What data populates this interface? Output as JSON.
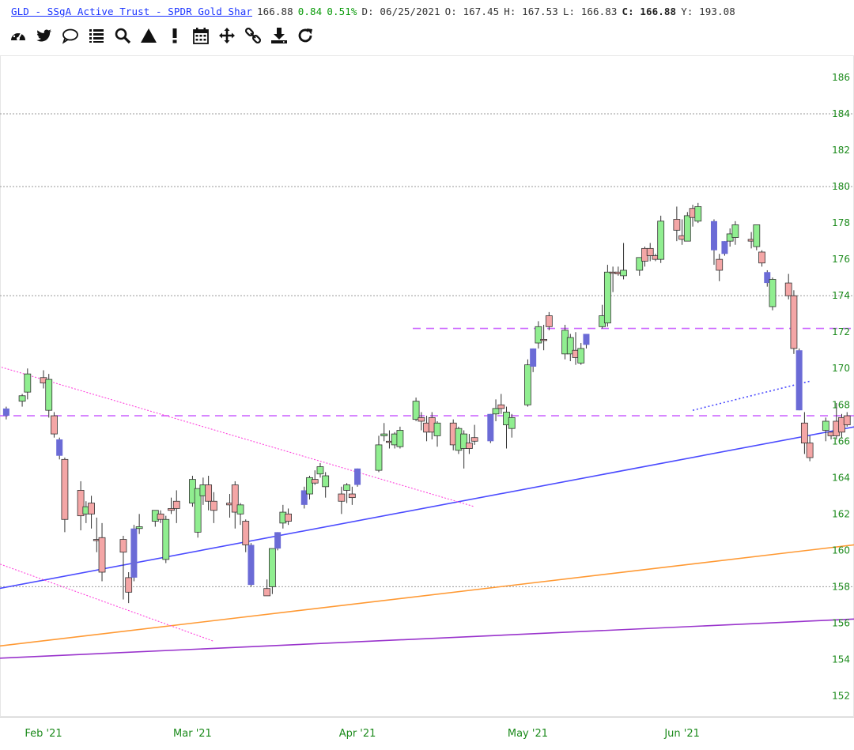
{
  "header": {
    "name": "GLD - SSgA Active Trust - SPDR Gold Shar",
    "last": "166.88",
    "change": "0.84",
    "change_pct": "0.51%",
    "date": "D: 06/25/2021",
    "open": "O: 167.45",
    "high": "H: 167.53",
    "low": "L: 166.83",
    "close_label": "C:",
    "close": "166.88",
    "yearly": "Y: 193.08"
  },
  "toolbar": [
    {
      "name": "dashboard-icon"
    },
    {
      "name": "twitter-icon"
    },
    {
      "name": "comment-icon"
    },
    {
      "name": "list-icon"
    },
    {
      "name": "search-icon"
    },
    {
      "name": "triangle-icon"
    },
    {
      "name": "alert-icon"
    },
    {
      "name": "calendar-icon"
    },
    {
      "name": "move-icon"
    },
    {
      "name": "link-icon"
    },
    {
      "name": "download-icon"
    },
    {
      "name": "refresh-icon"
    }
  ],
  "colors": {
    "up": "#90ee90",
    "down": "#f4a6a6",
    "gap_up": "#6b6bd6",
    "gap_down": "#6b6bd6",
    "tick": "#1b8a1b",
    "support": "#4b4bff",
    "orange_line": "#ff9933",
    "purple_line": "#9933cc",
    "pink_line": "#ff44dd",
    "hline": "#cc66ff"
  },
  "chart_data": {
    "type": "candlestick",
    "y_ticks": [
      "152",
      "154",
      "156",
      "158",
      "160",
      "162",
      "164",
      "166",
      "168",
      "170",
      "172",
      "174",
      "176",
      "178",
      "180",
      "182",
      "184",
      "186"
    ],
    "x_ticks": [
      {
        "label": "Feb '21",
        "date": "2021-02-01"
      },
      {
        "label": "Mar '21",
        "date": "2021-03-01"
      },
      {
        "label": "Apr '21",
        "date": "2021-04-01"
      },
      {
        "label": "May '21",
        "date": "2021-05-03"
      },
      {
        "label": "Jun '21",
        "date": "2021-06-01"
      }
    ],
    "ylim": [
      151.5,
      187
    ],
    "grid_levels": [
      158,
      174,
      180,
      184
    ],
    "horizontal_levels": [
      167.4,
      172.2
    ],
    "trendlines": [
      {
        "kind": "support",
        "from": [
          "2021-01-11",
          157.2
        ],
        "to": [
          "2021-07-09",
          167.1
        ]
      },
      {
        "kind": "support-extension",
        "from": [
          "2021-06-03",
          167.7
        ],
        "to": [
          "2021-06-25",
          169.3
        ]
      },
      {
        "kind": "orange",
        "from": [
          "2021-01-11",
          154.3
        ],
        "to": [
          "2021-07-09",
          160.5
        ]
      },
      {
        "kind": "purple",
        "from": [
          "2021-01-11",
          153.9
        ],
        "to": [
          "2021-07-09",
          156.3
        ]
      },
      {
        "kind": "pink-upper",
        "from": [
          "2021-01-11",
          171.2
        ],
        "to": [
          "2021-04-23",
          162.4
        ]
      },
      {
        "kind": "pink-lower",
        "from": [
          "2021-01-11",
          160.6
        ],
        "to": [
          "2021-03-05",
          155.0
        ]
      }
    ],
    "candles": [
      {
        "d": "2021-01-25",
        "o": 167.4,
        "h": 167.9,
        "l": 167.2,
        "c": 167.8,
        "s": "gap"
      },
      {
        "d": "2021-01-28",
        "o": 168.2,
        "h": 168.6,
        "l": 167.9,
        "c": 168.5,
        "s": "up"
      },
      {
        "d": "2021-01-29",
        "o": 168.7,
        "h": 170.0,
        "l": 168.3,
        "c": 169.7,
        "s": "up"
      },
      {
        "d": "2021-02-01",
        "o": 169.5,
        "h": 169.9,
        "l": 168.9,
        "c": 169.2,
        "s": "down"
      },
      {
        "d": "2021-02-02",
        "o": 169.4,
        "h": 169.7,
        "l": 167.3,
        "c": 167.7,
        "s": "up"
      },
      {
        "d": "2021-02-03",
        "o": 167.4,
        "h": 167.6,
        "l": 166.2,
        "c": 166.4,
        "s": "down"
      },
      {
        "d": "2021-02-04",
        "o": 166.1,
        "h": 166.2,
        "l": 165.0,
        "c": 165.2,
        "s": "gap"
      },
      {
        "d": "2021-02-05",
        "o": 165.0,
        "h": 165.1,
        "l": 161.0,
        "c": 161.7,
        "s": "down"
      },
      {
        "d": "2021-02-08",
        "o": 163.3,
        "h": 163.8,
        "l": 161.1,
        "c": 161.9,
        "s": "down"
      },
      {
        "d": "2021-02-09",
        "o": 162.0,
        "h": 162.7,
        "l": 161.5,
        "c": 162.4,
        "s": "up"
      },
      {
        "d": "2021-02-10",
        "o": 162.6,
        "h": 163.0,
        "l": 161.2,
        "c": 162.0,
        "s": "down"
      },
      {
        "d": "2021-02-11",
        "o": 160.6,
        "h": 161.8,
        "l": 159.9,
        "c": 160.6,
        "s": "down"
      },
      {
        "d": "2021-02-12",
        "o": 160.7,
        "h": 161.5,
        "l": 158.3,
        "c": 158.8,
        "s": "down"
      },
      {
        "d": "2021-02-16",
        "o": 160.6,
        "h": 160.8,
        "l": 157.3,
        "c": 159.9,
        "s": "down"
      },
      {
        "d": "2021-02-17",
        "o": 158.5,
        "h": 158.8,
        "l": 157.1,
        "c": 157.7,
        "s": "down"
      },
      {
        "d": "2021-02-18",
        "o": 158.5,
        "h": 161.4,
        "l": 158.3,
        "c": 161.2,
        "s": "gap"
      },
      {
        "d": "2021-02-19",
        "o": 161.2,
        "h": 162.0,
        "l": 160.9,
        "c": 161.3,
        "s": "up"
      },
      {
        "d": "2021-02-22",
        "o": 161.6,
        "h": 162.2,
        "l": 161.3,
        "c": 162.2,
        "s": "up"
      },
      {
        "d": "2021-02-23",
        "o": 162.0,
        "h": 162.2,
        "l": 161.5,
        "c": 161.7,
        "s": "down"
      },
      {
        "d": "2021-02-24",
        "o": 159.5,
        "h": 161.9,
        "l": 159.3,
        "c": 161.7,
        "s": "up"
      },
      {
        "d": "2021-02-25",
        "o": 162.2,
        "h": 162.9,
        "l": 162.0,
        "c": 162.3,
        "s": "down"
      },
      {
        "d": "2021-02-26",
        "o": 162.3,
        "h": 163.3,
        "l": 161.5,
        "c": 162.7,
        "s": "down"
      },
      {
        "d": "2021-03-01",
        "o": 162.6,
        "h": 164.1,
        "l": 162.4,
        "c": 163.9,
        "s": "up"
      },
      {
        "d": "2021-03-02",
        "o": 161.0,
        "h": 163.4,
        "l": 160.7,
        "c": 163.4,
        "s": "up"
      },
      {
        "d": "2021-03-03",
        "o": 163.0,
        "h": 164.0,
        "l": 162.5,
        "c": 163.6,
        "s": "up"
      },
      {
        "d": "2021-03-04",
        "o": 163.6,
        "h": 164.1,
        "l": 162.2,
        "c": 162.7,
        "s": "down"
      },
      {
        "d": "2021-03-05",
        "o": 162.7,
        "h": 163.2,
        "l": 161.5,
        "c": 162.2,
        "s": "down"
      },
      {
        "d": "2021-03-08",
        "o": 162.5,
        "h": 163.1,
        "l": 161.8,
        "c": 162.6,
        "s": "down"
      },
      {
        "d": "2021-03-09",
        "o": 163.6,
        "h": 163.8,
        "l": 161.2,
        "c": 162.1,
        "s": "down"
      },
      {
        "d": "2021-03-10",
        "o": 162.0,
        "h": 162.6,
        "l": 161.4,
        "c": 162.5,
        "s": "up"
      },
      {
        "d": "2021-03-11",
        "o": 161.6,
        "h": 161.7,
        "l": 159.9,
        "c": 160.3,
        "s": "down"
      },
      {
        "d": "2021-03-12",
        "o": 160.3,
        "h": 160.4,
        "l": 158.0,
        "c": 158.1,
        "s": "gap"
      },
      {
        "d": "2021-03-15",
        "o": 157.9,
        "h": 158.4,
        "l": 157.6,
        "c": 157.5,
        "s": "down"
      },
      {
        "d": "2021-03-16",
        "o": 158.0,
        "h": 160.1,
        "l": 157.6,
        "c": 160.1,
        "s": "up"
      },
      {
        "d": "2021-03-17",
        "o": 160.1,
        "h": 161.0,
        "l": 160.0,
        "c": 161.0,
        "s": "gap"
      },
      {
        "d": "2021-03-18",
        "o": 161.5,
        "h": 162.5,
        "l": 161.2,
        "c": 162.1,
        "s": "up"
      },
      {
        "d": "2021-03-19",
        "o": 162.0,
        "h": 162.3,
        "l": 161.4,
        "c": 161.6,
        "s": "down"
      },
      {
        "d": "2021-03-22",
        "o": 162.5,
        "h": 163.5,
        "l": 162.3,
        "c": 163.3,
        "s": "gap"
      },
      {
        "d": "2021-03-23",
        "o": 163.1,
        "h": 164.1,
        "l": 162.8,
        "c": 164.0,
        "s": "up"
      },
      {
        "d": "2021-03-24",
        "o": 163.9,
        "h": 164.4,
        "l": 163.6,
        "c": 163.7,
        "s": "down"
      },
      {
        "d": "2021-03-25",
        "o": 164.2,
        "h": 164.8,
        "l": 164.0,
        "c": 164.6,
        "s": "up"
      },
      {
        "d": "2021-03-26",
        "o": 163.5,
        "h": 164.3,
        "l": 162.9,
        "c": 164.1,
        "s": "up"
      },
      {
        "d": "2021-03-29",
        "o": 163.1,
        "h": 163.5,
        "l": 162.0,
        "c": 162.7,
        "s": "down"
      },
      {
        "d": "2021-03-30",
        "o": 163.3,
        "h": 163.7,
        "l": 162.6,
        "c": 163.6,
        "s": "up"
      },
      {
        "d": "2021-03-31",
        "o": 163.1,
        "h": 163.5,
        "l": 162.5,
        "c": 162.9,
        "s": "down"
      },
      {
        "d": "2021-04-01",
        "o": 163.6,
        "h": 164.5,
        "l": 163.5,
        "c": 164.5,
        "s": "gap"
      },
      {
        "d": "2021-04-05",
        "o": 164.4,
        "h": 166.3,
        "l": 164.3,
        "c": 165.8,
        "s": "up"
      },
      {
        "d": "2021-04-06",
        "o": 166.3,
        "h": 167.0,
        "l": 166.0,
        "c": 166.4,
        "s": "up"
      },
      {
        "d": "2021-04-07",
        "o": 166.0,
        "h": 166.6,
        "l": 165.6,
        "c": 166.0,
        "s": "down"
      },
      {
        "d": "2021-04-08",
        "o": 165.8,
        "h": 166.5,
        "l": 165.6,
        "c": 166.4,
        "s": "up"
      },
      {
        "d": "2021-04-09",
        "o": 165.7,
        "h": 166.8,
        "l": 165.6,
        "c": 166.6,
        "s": "up"
      },
      {
        "d": "2021-04-12",
        "o": 167.2,
        "h": 168.4,
        "l": 167.1,
        "c": 168.2,
        "s": "up"
      },
      {
        "d": "2021-04-13",
        "o": 167.3,
        "h": 167.6,
        "l": 166.6,
        "c": 167.1,
        "s": "down"
      },
      {
        "d": "2021-04-14",
        "o": 167.0,
        "h": 167.4,
        "l": 166.0,
        "c": 166.5,
        "s": "down"
      },
      {
        "d": "2021-04-15",
        "o": 167.3,
        "h": 167.6,
        "l": 166.1,
        "c": 166.5,
        "s": "down"
      },
      {
        "d": "2021-04-16",
        "o": 166.3,
        "h": 167.1,
        "l": 165.7,
        "c": 167.0,
        "s": "up"
      },
      {
        "d": "2021-04-19",
        "o": 167.0,
        "h": 167.2,
        "l": 165.5,
        "c": 165.8,
        "s": "down"
      },
      {
        "d": "2021-04-20",
        "o": 165.5,
        "h": 166.8,
        "l": 165.3,
        "c": 166.7,
        "s": "up"
      },
      {
        "d": "2021-04-21",
        "o": 166.4,
        "h": 166.6,
        "l": 164.5,
        "c": 165.6,
        "s": "up"
      },
      {
        "d": "2021-04-22",
        "o": 165.9,
        "h": 166.4,
        "l": 165.3,
        "c": 165.6,
        "s": "down"
      },
      {
        "d": "2021-04-23",
        "o": 166.0,
        "h": 166.9,
        "l": 165.8,
        "c": 166.2,
        "s": "down"
      },
      {
        "d": "2021-04-26",
        "o": 166.0,
        "h": 167.5,
        "l": 165.9,
        "c": 167.5,
        "s": "gap"
      },
      {
        "d": "2021-04-27",
        "o": 167.5,
        "h": 168.3,
        "l": 167.1,
        "c": 167.8,
        "s": "up"
      },
      {
        "d": "2021-04-28",
        "o": 168.0,
        "h": 168.6,
        "l": 167.5,
        "c": 167.8,
        "s": "down"
      },
      {
        "d": "2021-04-29",
        "o": 166.9,
        "h": 167.9,
        "l": 165.6,
        "c": 167.6,
        "s": "up"
      },
      {
        "d": "2021-04-30",
        "o": 166.7,
        "h": 167.5,
        "l": 166.2,
        "c": 167.3,
        "s": "up"
      },
      {
        "d": "2021-05-03",
        "o": 168.0,
        "h": 170.5,
        "l": 167.9,
        "c": 170.2,
        "s": "up"
      },
      {
        "d": "2021-05-04",
        "o": 170.1,
        "h": 171.1,
        "l": 169.8,
        "c": 171.1,
        "s": "gap"
      },
      {
        "d": "2021-05-05",
        "o": 171.4,
        "h": 172.6,
        "l": 171.1,
        "c": 172.3,
        "s": "up"
      },
      {
        "d": "2021-05-06",
        "o": 171.6,
        "h": 172.4,
        "l": 171.0,
        "c": 171.6,
        "s": "down"
      },
      {
        "d": "2021-05-07",
        "o": 172.9,
        "h": 173.1,
        "l": 172.1,
        "c": 172.3,
        "s": "down"
      },
      {
        "d": "2021-05-10",
        "o": 172.1,
        "h": 172.4,
        "l": 170.5,
        "c": 170.8,
        "s": "up"
      },
      {
        "d": "2021-05-11",
        "o": 170.8,
        "h": 171.9,
        "l": 170.4,
        "c": 171.7,
        "s": "up"
      },
      {
        "d": "2021-05-12",
        "o": 171.0,
        "h": 172.0,
        "l": 170.2,
        "c": 170.6,
        "s": "down"
      },
      {
        "d": "2021-05-13",
        "o": 170.3,
        "h": 171.4,
        "l": 170.2,
        "c": 171.1,
        "s": "up"
      },
      {
        "d": "2021-05-14",
        "o": 171.3,
        "h": 171.9,
        "l": 171.1,
        "c": 171.9,
        "s": "gap"
      },
      {
        "d": "2021-05-17",
        "o": 172.3,
        "h": 173.5,
        "l": 172.2,
        "c": 172.9,
        "s": "up"
      },
      {
        "d": "2021-05-18",
        "o": 172.5,
        "h": 175.7,
        "l": 172.3,
        "c": 175.3,
        "s": "up"
      },
      {
        "d": "2021-05-19",
        "o": 175.3,
        "h": 175.6,
        "l": 174.2,
        "c": 175.3,
        "s": "down"
      },
      {
        "d": "2021-05-20",
        "o": 175.3,
        "h": 175.6,
        "l": 175.1,
        "c": 175.2,
        "s": "down"
      },
      {
        "d": "2021-05-21",
        "o": 175.1,
        "h": 176.9,
        "l": 174.9,
        "c": 175.4,
        "s": "up"
      },
      {
        "d": "2021-05-24",
        "o": 175.4,
        "h": 176.1,
        "l": 175.1,
        "c": 176.1,
        "s": "up"
      },
      {
        "d": "2021-05-25",
        "o": 176.6,
        "h": 176.7,
        "l": 175.6,
        "c": 175.9,
        "s": "down"
      },
      {
        "d": "2021-05-26",
        "o": 176.2,
        "h": 176.9,
        "l": 175.9,
        "c": 176.6,
        "s": "down"
      },
      {
        "d": "2021-05-27",
        "o": 176.2,
        "h": 176.3,
        "l": 175.9,
        "c": 176.0,
        "s": "down"
      },
      {
        "d": "2021-05-28",
        "o": 176.0,
        "h": 178.4,
        "l": 175.8,
        "c": 178.1,
        "s": "up"
      },
      {
        "d": "2021-05-31",
        "o": 178.2,
        "h": 178.9,
        "l": 177.0,
        "c": 177.6,
        "s": "down"
      },
      {
        "d": "2021-06-01",
        "o": 177.3,
        "h": 178.2,
        "l": 176.8,
        "c": 177.1,
        "s": "down"
      },
      {
        "d": "2021-06-02",
        "o": 177.0,
        "h": 178.6,
        "l": 177.0,
        "c": 178.4,
        "s": "up"
      },
      {
        "d": "2021-06-03",
        "o": 178.8,
        "h": 179.0,
        "l": 177.8,
        "c": 178.3,
        "s": "down"
      },
      {
        "d": "2021-06-04",
        "o": 178.1,
        "h": 179.1,
        "l": 178.0,
        "c": 178.9,
        "s": "up"
      },
      {
        "d": "2021-06-07",
        "o": 178.1,
        "h": 178.2,
        "l": 175.7,
        "c": 176.5,
        "s": "gap"
      },
      {
        "d": "2021-06-08",
        "o": 176.0,
        "h": 176.3,
        "l": 174.8,
        "c": 175.4,
        "s": "down"
      },
      {
        "d": "2021-06-09",
        "o": 176.3,
        "h": 177.0,
        "l": 176.2,
        "c": 177.0,
        "s": "gap"
      },
      {
        "d": "2021-06-10",
        "o": 177.0,
        "h": 177.7,
        "l": 176.7,
        "c": 177.4,
        "s": "up"
      },
      {
        "d": "2021-06-11",
        "o": 177.2,
        "h": 178.1,
        "l": 176.8,
        "c": 177.9,
        "s": "up"
      },
      {
        "d": "2021-06-14",
        "o": 177.0,
        "h": 177.5,
        "l": 176.6,
        "c": 177.1,
        "s": "down"
      },
      {
        "d": "2021-06-15",
        "o": 176.7,
        "h": 177.9,
        "l": 176.5,
        "c": 177.9,
        "s": "up"
      },
      {
        "d": "2021-06-16",
        "o": 176.4,
        "h": 176.5,
        "l": 175.6,
        "c": 175.8,
        "s": "down"
      },
      {
        "d": "2021-06-17",
        "o": 175.3,
        "h": 175.4,
        "l": 174.5,
        "c": 174.7,
        "s": "gap"
      },
      {
        "d": "2021-06-18",
        "o": 173.4,
        "h": 175.0,
        "l": 173.2,
        "c": 174.9,
        "s": "up"
      },
      {
        "d": "2021-06-21",
        "o": 174.7,
        "h": 175.2,
        "l": 173.8,
        "c": 174.0,
        "s": "down"
      },
      {
        "d": "2021-06-22",
        "o": 174.0,
        "h": 174.3,
        "l": 170.8,
        "c": 171.1,
        "s": "down"
      },
      {
        "d": "2021-06-23",
        "o": 171.0,
        "h": 171.1,
        "l": 167.7,
        "c": 167.7,
        "s": "gap"
      },
      {
        "d": "2021-06-24",
        "o": 167.0,
        "h": 167.6,
        "l": 165.3,
        "c": 165.9,
        "s": "down"
      },
      {
        "d": "2021-06-25",
        "o": 165.9,
        "h": 166.3,
        "l": 164.9,
        "c": 165.1,
        "s": "down"
      },
      {
        "d": "2021-06-28",
        "o": 166.6,
        "h": 167.3,
        "l": 166.0,
        "c": 167.1,
        "s": "up"
      },
      {
        "d": "2021-06-29",
        "o": 166.3,
        "h": 166.5,
        "l": 166.1,
        "c": 166.5,
        "s": "down"
      },
      {
        "d": "2021-06-30",
        "o": 167.1,
        "h": 168.1,
        "l": 166.1,
        "c": 166.3,
        "s": "down"
      },
      {
        "d": "2021-07-01",
        "o": 167.3,
        "h": 167.5,
        "l": 166.2,
        "c": 166.5,
        "s": "down"
      },
      {
        "d": "2021-07-02",
        "o": 167.4,
        "h": 167.6,
        "l": 166.8,
        "c": 166.9,
        "s": "down"
      }
    ]
  }
}
